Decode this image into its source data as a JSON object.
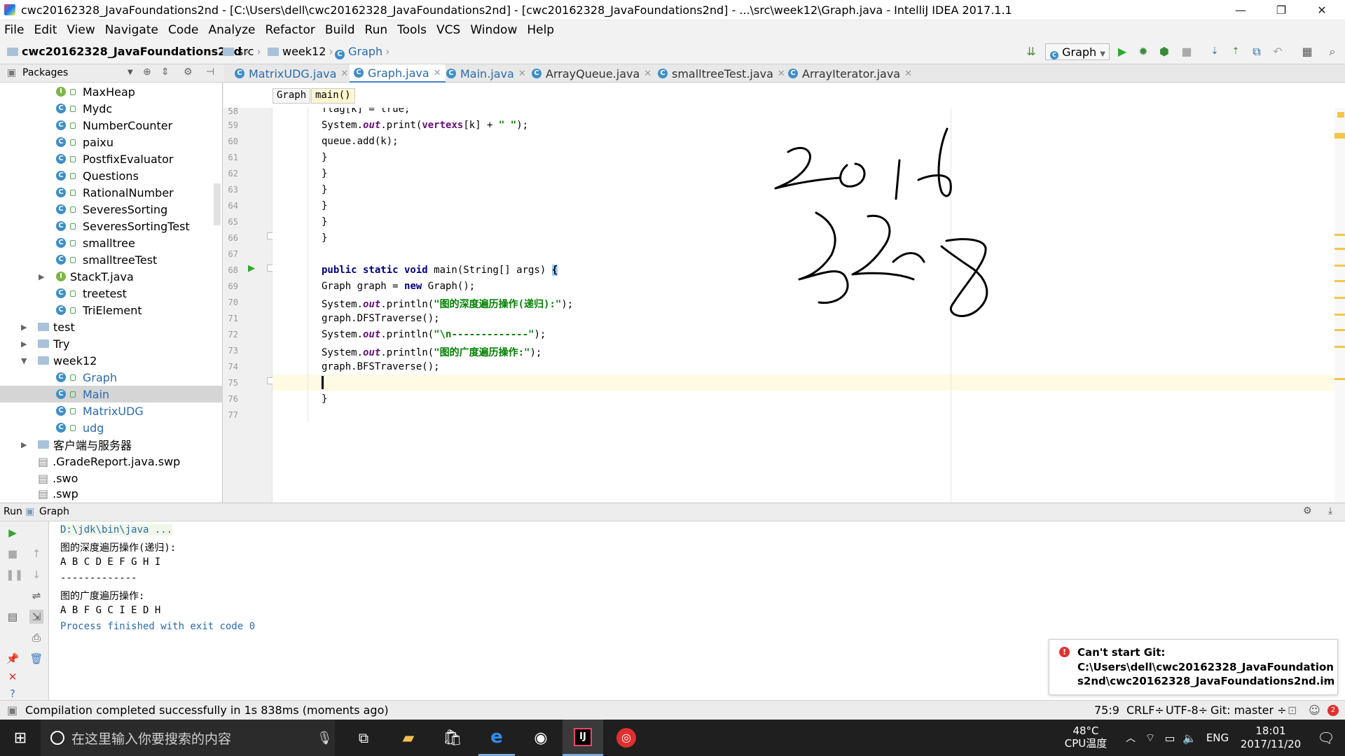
{
  "window": {
    "title": "cwc20162328_JavaFoundations2nd - [C:\\Users\\dell\\cwc20162328_JavaFoundations2nd] - [cwc20162328_JavaFoundations2nd] - ...\\src\\week12\\Graph.java - IntelliJ IDEA 2017.1.1",
    "minimize": "—",
    "restore": "❐",
    "close": "✕"
  },
  "menu": [
    "File",
    "Edit",
    "View",
    "Navigate",
    "Code",
    "Analyze",
    "Refactor",
    "Build",
    "Run",
    "Tools",
    "VCS",
    "Window",
    "Help"
  ],
  "nav": {
    "project": "cwc20162328_JavaFoundations2nd",
    "src": "src",
    "pkg": "week12",
    "cls": "Graph",
    "run_config": "Graph"
  },
  "project_panel": {
    "title": "Packages",
    "items": [
      {
        "label": "MaxHeap",
        "kind": "interface"
      },
      {
        "label": "Mydc",
        "kind": "class"
      },
      {
        "label": "NumberCounter",
        "kind": "class"
      },
      {
        "label": "paixu",
        "kind": "class"
      },
      {
        "label": "PostfixEvaluator",
        "kind": "class"
      },
      {
        "label": "Questions",
        "kind": "class"
      },
      {
        "label": "RationalNumber",
        "kind": "class"
      },
      {
        "label": "SeveresSorting",
        "kind": "class"
      },
      {
        "label": "SeveresSortingTest",
        "kind": "class"
      },
      {
        "label": "smalltree",
        "kind": "class"
      },
      {
        "label": "smalltreeTest",
        "kind": "class"
      },
      {
        "label": "StackT.java",
        "kind": "interface"
      },
      {
        "label": "treetest",
        "kind": "class"
      },
      {
        "label": "TriElement",
        "kind": "class"
      },
      {
        "label": "test",
        "kind": "folder"
      },
      {
        "label": "Try",
        "kind": "folder"
      },
      {
        "label": "week12",
        "kind": "folder"
      },
      {
        "label": "Graph",
        "kind": "class"
      },
      {
        "label": "Main",
        "kind": "class"
      },
      {
        "label": "MatrixUDG",
        "kind": "class"
      },
      {
        "label": "udg",
        "kind": "class"
      },
      {
        "label": "客户端与服务器",
        "kind": "folder"
      },
      {
        "label": ".GradeReport.java.swp",
        "kind": "file"
      },
      {
        "label": ".swo",
        "kind": "file"
      },
      {
        "label": ".swp",
        "kind": "file"
      }
    ]
  },
  "tabs": [
    "MatrixUDG.java",
    "Graph.java",
    "Main.java",
    "ArrayQueue.java",
    "smalltreeTest.java",
    "ArrayIterator.java"
  ],
  "breadcrumb": {
    "cls": "Graph",
    "method": "main()"
  },
  "editor": {
    "line_numbers": [
      "58",
      "59",
      "60",
      "61",
      "62",
      "63",
      "64",
      "65",
      "66",
      "67",
      "68",
      "69",
      "70",
      "71",
      "72",
      "73",
      "74",
      "75",
      "76",
      "77"
    ],
    "code": {
      "l58": "flag[k] = true;",
      "l59a": "System.",
      "l59b": "out",
      "l59c": ".print(",
      "l59d": "vertexs",
      "l59e": "[k] + ",
      "l59f": "\" \"",
      "l59g": ");",
      "l60": "queue.add(k);",
      "brace_close": "}",
      "l68a": "public static void",
      "l68b": " main(String[] args) ",
      "l68c": "{",
      "l69a": "Graph graph = ",
      "l69b": "new",
      "l69c": " Graph();",
      "l70a": "System.",
      "l70b": "out",
      "l70c": ".println(",
      "l70d": "\"图的深度遍历操作(递归):\"",
      "l70e": ");",
      "l71": "graph.DFSTraverse();",
      "l72a": "System.",
      "l72b": "out",
      "l72c": ".println(",
      "l72d": "\"\\n-------------\"",
      "l72e": ");",
      "l73a": "System.",
      "l73b": "out",
      "l73c": ".println(",
      "l73d": "\"图的广度遍历操作:\"",
      "l73e": ");",
      "l74": "graph.BFSTraverse();"
    }
  },
  "run": {
    "title": "Run",
    "config": "Graph",
    "console": [
      "D:\\jdk\\bin\\java ...",
      "图的深度遍历操作(递归):",
      "A B C D E F G H I",
      "-------------",
      "图的广度遍历操作:",
      "A B F G C I E D H",
      "Process finished with exit code 0"
    ]
  },
  "notification": {
    "title": "Can't start Git:",
    "line1": "C:\\Users\\dell\\cwc20162328_JavaFoundation",
    "line2": "s2nd\\cwc20162328_JavaFoundations2nd.im"
  },
  "status": {
    "message": "Compilation completed successfully in 1s 838ms (moments ago)",
    "position": "75:9",
    "line_sep": "CRLF÷",
    "encoding": "UTF-8÷",
    "git": "Git: master ÷"
  },
  "taskbar": {
    "search": "在这里输入你要搜索的内容",
    "temp": "48°C",
    "temp_label": "CPU温度",
    "lang": "ENG",
    "time": "18:01",
    "date": "2017/11/20"
  },
  "colors": {
    "accent": "#4083c9",
    "keyword": "#000080",
    "string": "#008000",
    "field": "#660e7a",
    "error": "#e03030"
  }
}
